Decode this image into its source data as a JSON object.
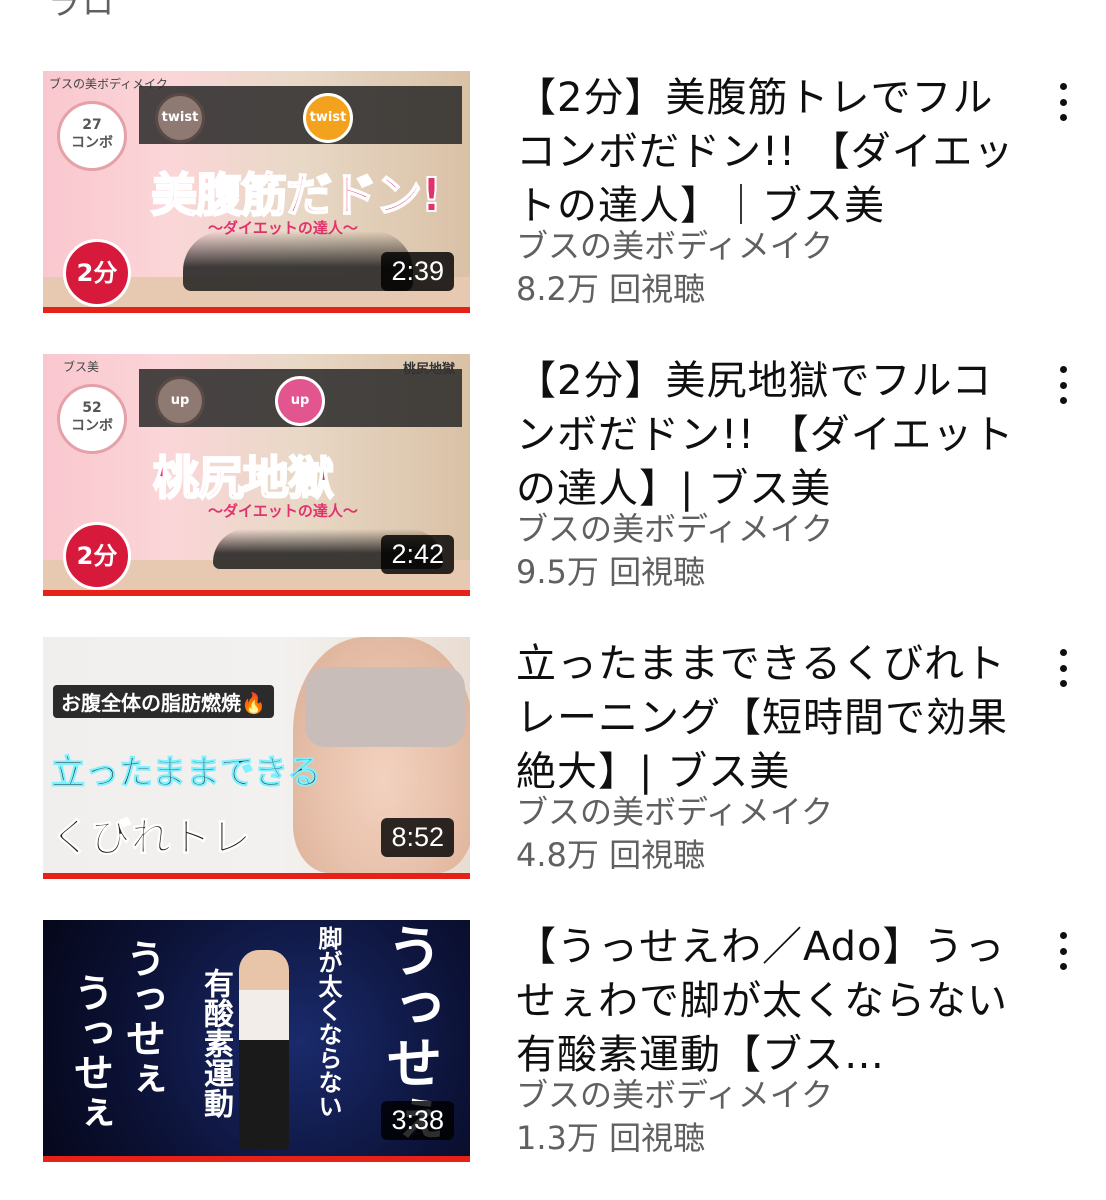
{
  "top_fragment": "ラロ",
  "videos": [
    {
      "title": "【2分】美腹筋トレでフルコンボだドン!! 【ダイエットの達人】｜ブス美",
      "channel": "ブスの美ボディメイク",
      "views": "8.2万 回視聴",
      "duration": "2:39",
      "thumb": {
        "channel_tag": "ブスの美ボディメイク",
        "combo": "27",
        "combo_label": "コンボ",
        "badge1": "twist",
        "badge2": "twist",
        "big_text": "美腹筋だドン!",
        "sub_text": "～ダイエットの達人～",
        "timer": "2分"
      }
    },
    {
      "title": "【2分】美尻地獄でフルコンボだドン!! 【ダイエットの達人】| ブス美",
      "channel": "ブスの美ボディメイク",
      "views": "9.5万 回視聴",
      "duration": "2:42",
      "thumb": {
        "channel_tag": "ブス美",
        "combo": "52",
        "combo_label": "コンボ",
        "badge1": "up",
        "badge2": "up",
        "big_text": "桃尻地獄",
        "sub_text": "～ダイエットの達人～",
        "timer": "2分",
        "corner_text": "桃尻地獄"
      }
    },
    {
      "title": "立ったままできるくびれトレーニング【短時間で効果絶大】| ブス美",
      "channel": "ブスの美ボディメイク",
      "views": "4.8万 回視聴",
      "duration": "8:52",
      "thumb": {
        "pill": "お腹全体の脂肪燃焼🔥",
        "line1": "立ったままできる",
        "line2": "くびれトレ"
      }
    },
    {
      "title": "【うっせえわ／Ado】うっせぇわで脚が太くならない有酸素運動【ブス…",
      "channel": "ブスの美ボディメイク",
      "views": "1.3万 回視聴",
      "duration": "3:38",
      "thumb": {
        "col1": "うっせぇ",
        "col2": "うっせぇ",
        "col3": "有酸素運動",
        "col4": "脚が太くならない",
        "col5": "うっせぇ"
      }
    }
  ]
}
